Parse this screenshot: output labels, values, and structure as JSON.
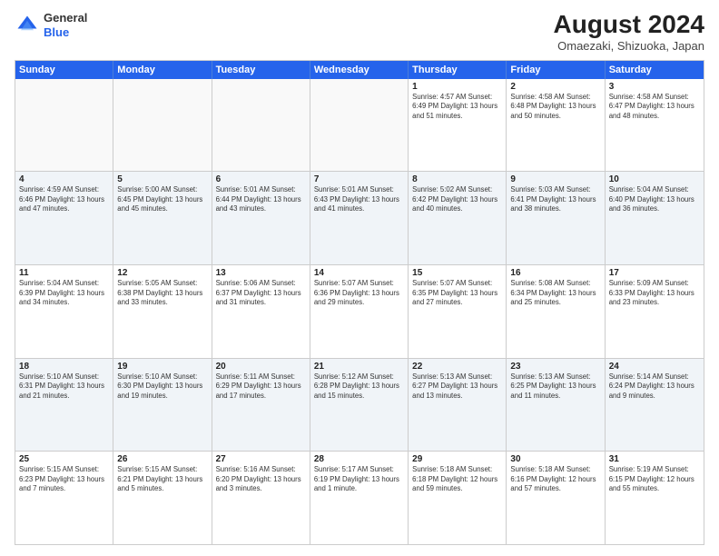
{
  "logo": {
    "general": "General",
    "blue": "Blue"
  },
  "header": {
    "month_year": "August 2024",
    "location": "Omaezaki, Shizuoka, Japan"
  },
  "weekdays": [
    "Sunday",
    "Monday",
    "Tuesday",
    "Wednesday",
    "Thursday",
    "Friday",
    "Saturday"
  ],
  "rows": [
    [
      {
        "day": "",
        "info": "",
        "empty": true
      },
      {
        "day": "",
        "info": "",
        "empty": true
      },
      {
        "day": "",
        "info": "",
        "empty": true
      },
      {
        "day": "",
        "info": "",
        "empty": true
      },
      {
        "day": "1",
        "info": "Sunrise: 4:57 AM\nSunset: 6:49 PM\nDaylight: 13 hours\nand 51 minutes."
      },
      {
        "day": "2",
        "info": "Sunrise: 4:58 AM\nSunset: 6:48 PM\nDaylight: 13 hours\nand 50 minutes."
      },
      {
        "day": "3",
        "info": "Sunrise: 4:58 AM\nSunset: 6:47 PM\nDaylight: 13 hours\nand 48 minutes."
      }
    ],
    [
      {
        "day": "4",
        "info": "Sunrise: 4:59 AM\nSunset: 6:46 PM\nDaylight: 13 hours\nand 47 minutes."
      },
      {
        "day": "5",
        "info": "Sunrise: 5:00 AM\nSunset: 6:45 PM\nDaylight: 13 hours\nand 45 minutes."
      },
      {
        "day": "6",
        "info": "Sunrise: 5:01 AM\nSunset: 6:44 PM\nDaylight: 13 hours\nand 43 minutes."
      },
      {
        "day": "7",
        "info": "Sunrise: 5:01 AM\nSunset: 6:43 PM\nDaylight: 13 hours\nand 41 minutes."
      },
      {
        "day": "8",
        "info": "Sunrise: 5:02 AM\nSunset: 6:42 PM\nDaylight: 13 hours\nand 40 minutes."
      },
      {
        "day": "9",
        "info": "Sunrise: 5:03 AM\nSunset: 6:41 PM\nDaylight: 13 hours\nand 38 minutes."
      },
      {
        "day": "10",
        "info": "Sunrise: 5:04 AM\nSunset: 6:40 PM\nDaylight: 13 hours\nand 36 minutes."
      }
    ],
    [
      {
        "day": "11",
        "info": "Sunrise: 5:04 AM\nSunset: 6:39 PM\nDaylight: 13 hours\nand 34 minutes."
      },
      {
        "day": "12",
        "info": "Sunrise: 5:05 AM\nSunset: 6:38 PM\nDaylight: 13 hours\nand 33 minutes."
      },
      {
        "day": "13",
        "info": "Sunrise: 5:06 AM\nSunset: 6:37 PM\nDaylight: 13 hours\nand 31 minutes."
      },
      {
        "day": "14",
        "info": "Sunrise: 5:07 AM\nSunset: 6:36 PM\nDaylight: 13 hours\nand 29 minutes."
      },
      {
        "day": "15",
        "info": "Sunrise: 5:07 AM\nSunset: 6:35 PM\nDaylight: 13 hours\nand 27 minutes."
      },
      {
        "day": "16",
        "info": "Sunrise: 5:08 AM\nSunset: 6:34 PM\nDaylight: 13 hours\nand 25 minutes."
      },
      {
        "day": "17",
        "info": "Sunrise: 5:09 AM\nSunset: 6:33 PM\nDaylight: 13 hours\nand 23 minutes."
      }
    ],
    [
      {
        "day": "18",
        "info": "Sunrise: 5:10 AM\nSunset: 6:31 PM\nDaylight: 13 hours\nand 21 minutes."
      },
      {
        "day": "19",
        "info": "Sunrise: 5:10 AM\nSunset: 6:30 PM\nDaylight: 13 hours\nand 19 minutes."
      },
      {
        "day": "20",
        "info": "Sunrise: 5:11 AM\nSunset: 6:29 PM\nDaylight: 13 hours\nand 17 minutes."
      },
      {
        "day": "21",
        "info": "Sunrise: 5:12 AM\nSunset: 6:28 PM\nDaylight: 13 hours\nand 15 minutes."
      },
      {
        "day": "22",
        "info": "Sunrise: 5:13 AM\nSunset: 6:27 PM\nDaylight: 13 hours\nand 13 minutes."
      },
      {
        "day": "23",
        "info": "Sunrise: 5:13 AM\nSunset: 6:25 PM\nDaylight: 13 hours\nand 11 minutes."
      },
      {
        "day": "24",
        "info": "Sunrise: 5:14 AM\nSunset: 6:24 PM\nDaylight: 13 hours\nand 9 minutes."
      }
    ],
    [
      {
        "day": "25",
        "info": "Sunrise: 5:15 AM\nSunset: 6:23 PM\nDaylight: 13 hours\nand 7 minutes."
      },
      {
        "day": "26",
        "info": "Sunrise: 5:15 AM\nSunset: 6:21 PM\nDaylight: 13 hours\nand 5 minutes."
      },
      {
        "day": "27",
        "info": "Sunrise: 5:16 AM\nSunset: 6:20 PM\nDaylight: 13 hours\nand 3 minutes."
      },
      {
        "day": "28",
        "info": "Sunrise: 5:17 AM\nSunset: 6:19 PM\nDaylight: 13 hours\nand 1 minute."
      },
      {
        "day": "29",
        "info": "Sunrise: 5:18 AM\nSunset: 6:18 PM\nDaylight: 12 hours\nand 59 minutes."
      },
      {
        "day": "30",
        "info": "Sunrise: 5:18 AM\nSunset: 6:16 PM\nDaylight: 12 hours\nand 57 minutes."
      },
      {
        "day": "31",
        "info": "Sunrise: 5:19 AM\nSunset: 6:15 PM\nDaylight: 12 hours\nand 55 minutes."
      }
    ]
  ]
}
